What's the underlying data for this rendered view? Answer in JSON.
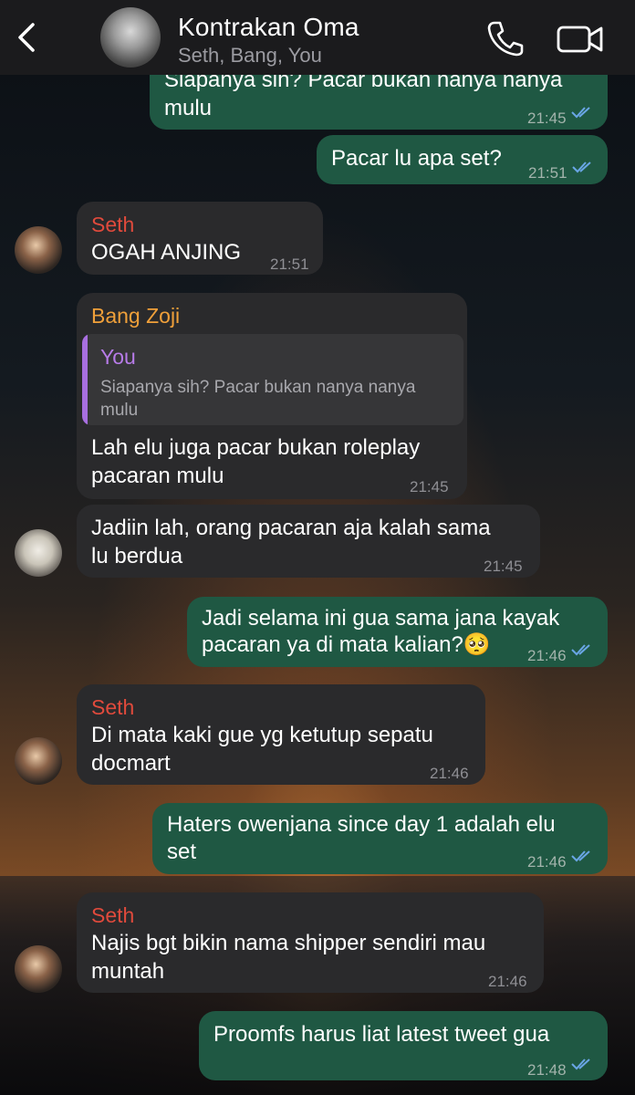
{
  "header": {
    "title": "Kontrakan Oma",
    "subtitle": "Seth, Bang, You",
    "back_icon": "chevron-left-icon",
    "call_icon": "phone-icon",
    "video_icon": "video-camera-icon"
  },
  "colors": {
    "outgoing_bubble": "#1f5843",
    "incoming_bubble": "#2a2a2c",
    "seth_name": "#e04a3c",
    "zoji_name": "#f0a03a",
    "quote_you": "#b77be8",
    "read_ticks": "#6aa6e6"
  },
  "messages": [
    {
      "direction": "out",
      "lines": [
        "Siapanya sih? Pacar bukan nanya nanya",
        "mulu"
      ],
      "time": "21:45",
      "read": true
    },
    {
      "direction": "out",
      "lines": [
        "Pacar lu apa set?"
      ],
      "time": "21:51",
      "read": true
    },
    {
      "direction": "in",
      "sender": "Seth",
      "lines": [
        "OGAH ANJING"
      ],
      "time": "21:51"
    },
    {
      "direction": "in",
      "sender": "Bang Zoji",
      "quote": {
        "name": "You",
        "text": "Siapanya sih? Pacar bukan nanya nanya mulu"
      },
      "lines": [
        "Lah elu juga pacar bukan roleplay",
        "pacaran mulu"
      ],
      "time": "21:45"
    },
    {
      "direction": "in",
      "lines": [
        "Jadiin lah, orang pacaran aja kalah sama",
        "lu berdua"
      ],
      "time": "21:45"
    },
    {
      "direction": "out",
      "lines": [
        "Jadi selama ini gua sama jana kayak",
        "pacaran ya di mata kalian?🥺"
      ],
      "time": "21:46",
      "read": true
    },
    {
      "direction": "in",
      "sender": "Seth",
      "lines": [
        "Di mata kaki gue yg ketutup sepatu",
        "docmart"
      ],
      "time": "21:46"
    },
    {
      "direction": "out",
      "lines": [
        "Haters owenjana since day 1 adalah elu",
        "set"
      ],
      "time": "21:46",
      "read": true
    },
    {
      "direction": "in",
      "sender": "Seth",
      "lines": [
        "Najis bgt bikin nama shipper sendiri mau",
        "muntah"
      ],
      "time": "21:46"
    },
    {
      "direction": "out",
      "lines": [
        "Proomfs harus liat latest tweet gua"
      ],
      "time": "21:48",
      "read": true
    }
  ]
}
